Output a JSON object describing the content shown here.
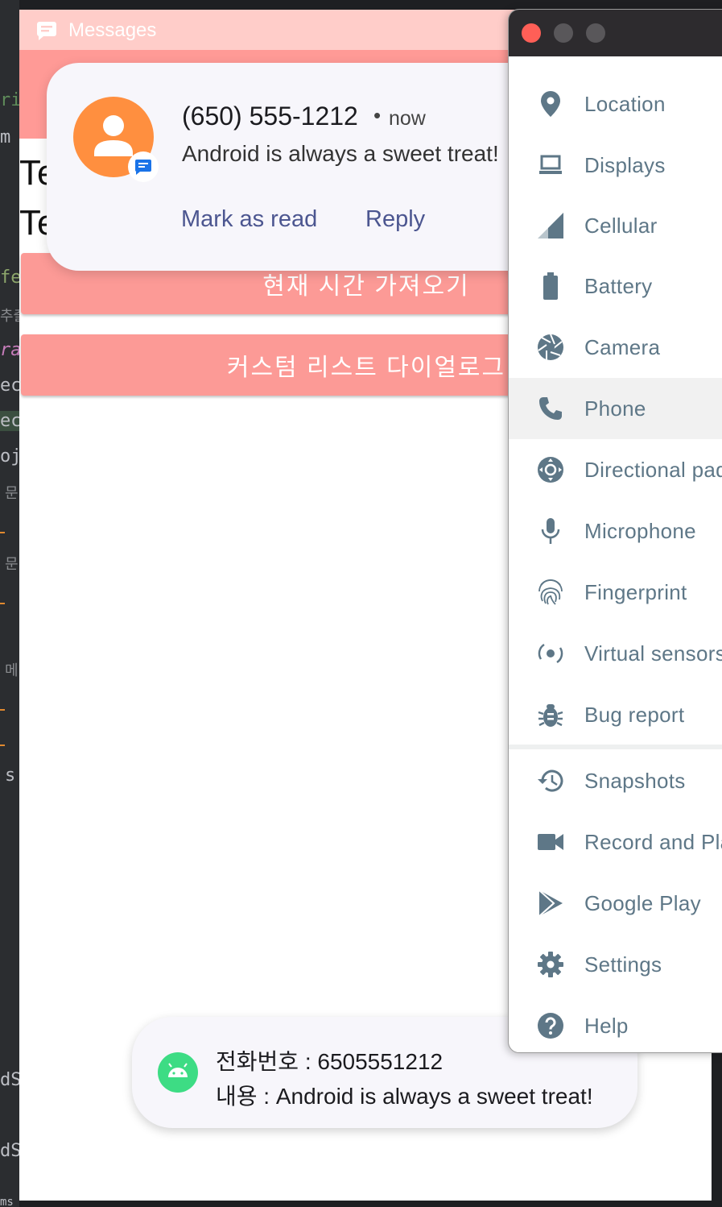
{
  "ide": {
    "fragments": [
      "ri",
      "m",
      "fe",
      "추출",
      "ra",
      "ec",
      "ec",
      "oj",
      "문",
      "문",
      "메",
      "s",
      "dS",
      "dS",
      "ms"
    ]
  },
  "app": {
    "title": "Messages",
    "text_line_1": "Te",
    "text_line_2": "Te",
    "button_time": "현재 시간 가져오기",
    "button_dialog": "커스텀 리스트 다이얼로그",
    "colors": {
      "app_bar": "#ffcdc9",
      "accent": "#fc9a96"
    }
  },
  "notification": {
    "sender": "(650) 555-1212",
    "separator": "•",
    "time": "now",
    "body": "Android is always a sweet treat!",
    "actions": [
      "Mark as read",
      "Reply"
    ],
    "avatar_icon": "person-icon",
    "badge_icon": "messages-icon"
  },
  "toast": {
    "line_1": "전화번호 : 6505551212",
    "line_2": "내용 : Android is always a sweet treat!",
    "icon": "android-icon"
  },
  "extended_controls": {
    "items": [
      {
        "label": "Location",
        "icon": "location-pin-icon"
      },
      {
        "label": "Displays",
        "icon": "monitor-icon"
      },
      {
        "label": "Cellular",
        "icon": "cellular-signal-icon"
      },
      {
        "label": "Battery",
        "icon": "battery-icon"
      },
      {
        "label": "Camera",
        "icon": "camera-shutter-icon"
      },
      {
        "label": "Phone",
        "icon": "phone-icon",
        "selected": true
      },
      {
        "label": "Directional pad",
        "icon": "dpad-icon"
      },
      {
        "label": "Microphone",
        "icon": "microphone-icon"
      },
      {
        "label": "Fingerprint",
        "icon": "fingerprint-icon"
      },
      {
        "label": "Virtual sensors",
        "icon": "virtual-sensors-icon"
      },
      {
        "label": "Bug report",
        "icon": "bug-icon"
      },
      {
        "label": "Snapshots",
        "icon": "history-icon"
      },
      {
        "label": "Record and Playback",
        "icon": "video-camera-icon"
      },
      {
        "label": "Google Play",
        "icon": "play-store-icon"
      },
      {
        "label": "Settings",
        "icon": "gear-icon"
      },
      {
        "label": "Help",
        "icon": "help-icon"
      }
    ],
    "colors": {
      "label": "#5e7787",
      "icon": "#5e7787",
      "titlebar": "#2d2b2e"
    }
  }
}
